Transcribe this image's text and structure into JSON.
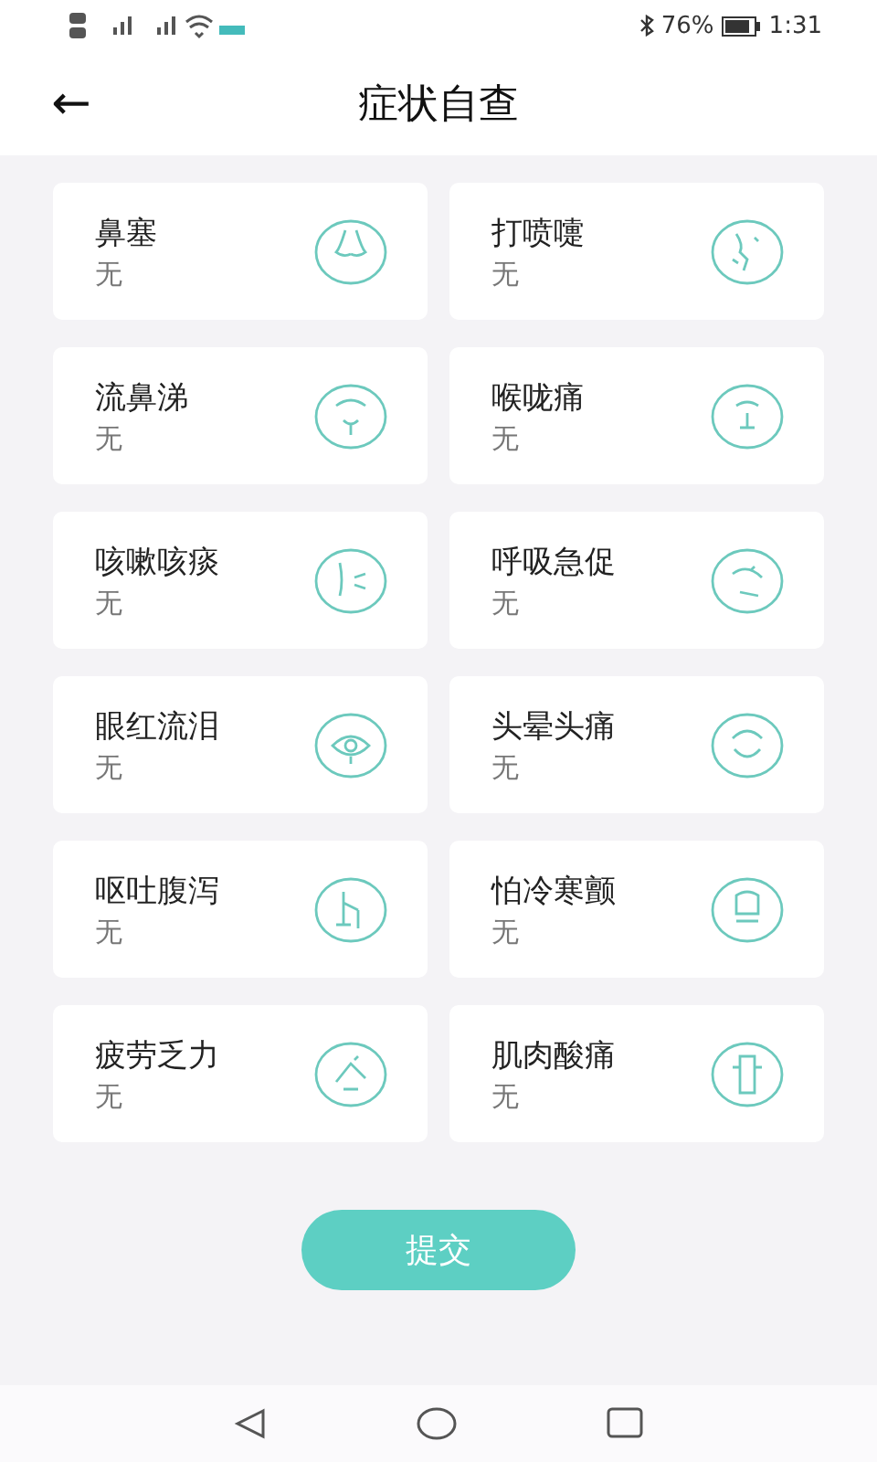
{
  "status_bar": {
    "battery": "76%",
    "time": "1:31"
  },
  "header": {
    "back": "←",
    "title": "症状自查"
  },
  "symptoms": [
    {
      "name": "鼻塞",
      "value": "无"
    },
    {
      "name": "打喷嚏",
      "value": "无"
    },
    {
      "name": "流鼻涕",
      "value": "无"
    },
    {
      "name": "喉咙痛",
      "value": "无"
    },
    {
      "name": "咳嗽咳痰",
      "value": "无"
    },
    {
      "name": "呼吸急促",
      "value": "无"
    },
    {
      "name": "眼红流泪",
      "value": "无"
    },
    {
      "name": "头晕头痛",
      "value": "无"
    },
    {
      "name": "呕吐腹泻",
      "value": "无"
    },
    {
      "name": "怕冷寒颤",
      "value": "无"
    },
    {
      "name": "疲劳乏力",
      "value": "无"
    },
    {
      "name": "肌肉酸痛",
      "value": "无"
    }
  ],
  "submit": "提交"
}
